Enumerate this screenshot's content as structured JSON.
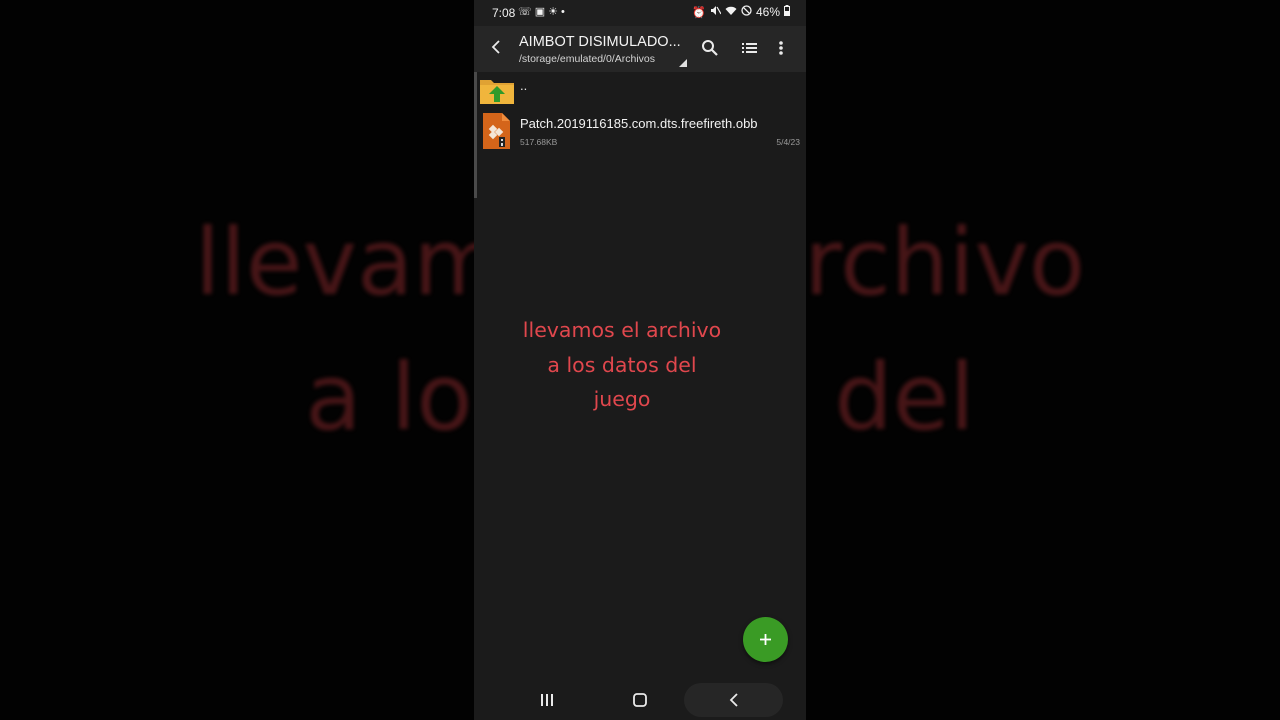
{
  "background_caption": {
    "lines": [
      "llevamos el archivo",
      "a los datos del",
      "juego"
    ]
  },
  "status_bar": {
    "time": "7:08",
    "left_icons": [
      "whatsapp-icon",
      "screenshot-icon",
      "weather-icon",
      "dot"
    ],
    "right_icons": [
      "alarm-icon",
      "mute-icon",
      "wifi-icon",
      "do-not-disturb-icon",
      "battery-icon"
    ],
    "battery": "46%"
  },
  "app_bar": {
    "title": "AIMBOT DISIMULADO...",
    "path": "/storage/emulated/0/Archivos",
    "icons": [
      "back-arrow-icon",
      "search-icon",
      "list-view-icon",
      "more-vert-icon"
    ]
  },
  "file_list": {
    "parent_label": "..",
    "items": [
      {
        "name": "Patch.2019116185.com.dts.freefireth.obb",
        "size": "517.68KB",
        "date": "5/4/23",
        "icon": "archive-file-icon"
      }
    ]
  },
  "caption": {
    "lines": [
      "llevamos el archivo",
      "a los datos del",
      "juego"
    ],
    "color": "#e0474d"
  },
  "fab": {
    "icon": "plus-icon",
    "color": "#3a9b25"
  },
  "nav_bar": {
    "icons": [
      "recents-icon",
      "home-icon",
      "back-icon"
    ]
  }
}
